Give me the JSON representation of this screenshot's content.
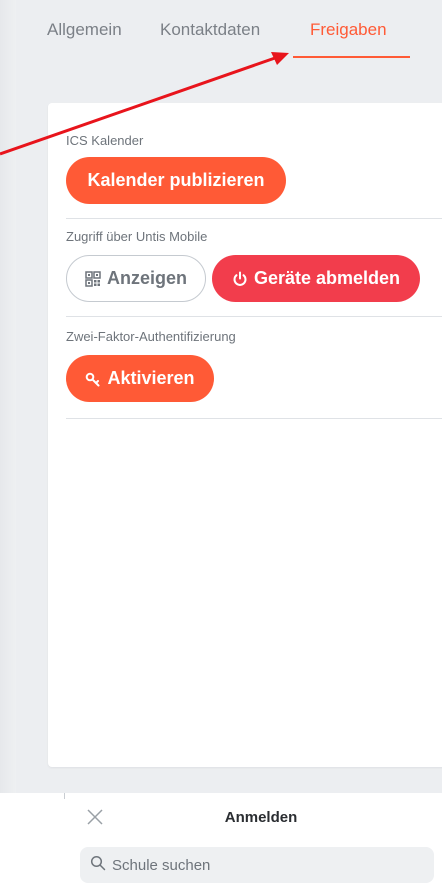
{
  "tabs": [
    {
      "label": "Allgemein",
      "active": false
    },
    {
      "label": "Kontaktdaten",
      "active": false
    },
    {
      "label": "Freigaben",
      "active": true
    }
  ],
  "sections": {
    "ics": {
      "label": "ICS Kalender",
      "button": "Kalender publizieren"
    },
    "untis": {
      "label": "Zugriff über Untis Mobile",
      "show_button": "Anzeigen",
      "logout_button": "Geräte abmelden"
    },
    "twofa": {
      "label": "Zwei-Faktor-Authentifizierung",
      "button": "Aktivieren"
    }
  },
  "login_sheet": {
    "title": "Anmelden",
    "search_placeholder": "Schule suchen"
  },
  "colors": {
    "accent": "#ff5a36",
    "danger": "#f23d4c",
    "annotation_arrow": "#e8141c"
  },
  "icons": {
    "qr": "qr-code-icon",
    "power": "power-icon",
    "key": "key-icon",
    "close": "close-icon",
    "search": "search-icon"
  }
}
